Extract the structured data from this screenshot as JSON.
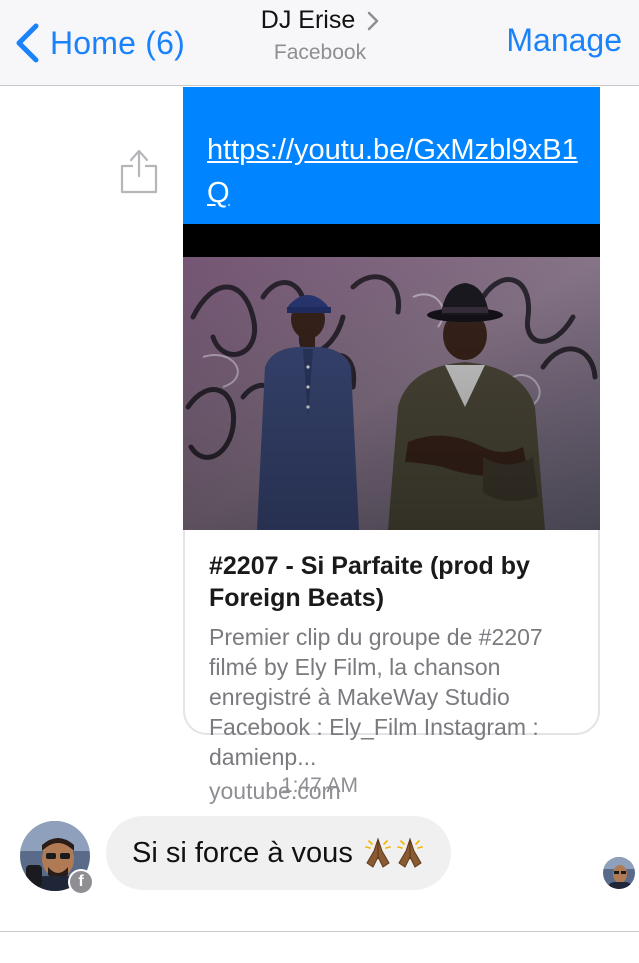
{
  "header": {
    "back_label": "Home (6)",
    "title": "DJ Erise",
    "subtitle": "Facebook",
    "manage_label": "Manage",
    "back_icon": "chevron-left-icon",
    "title_chevron_icon": "chevron-right-icon"
  },
  "card": {
    "link_text": "https://youtu.be/GxMzbl9xB1Q",
    "title": "#2207 - Si Parfaite (prod by Foreign Beats)",
    "description": "Premier clip du groupe de #2207 filmé by Ely Film, la chanson enregistré à MakeWay Studio Facebook : Ely_Film Instagram : damienp...",
    "domain": "youtube.com"
  },
  "timestamp": "1:47 AM",
  "message": {
    "text": "Si si force à vous",
    "emoji": "🙏🙏"
  },
  "colors": {
    "accent": "#1a82fb",
    "link_bg": "#0084ff",
    "bubble_bg": "#f1f0f0"
  }
}
